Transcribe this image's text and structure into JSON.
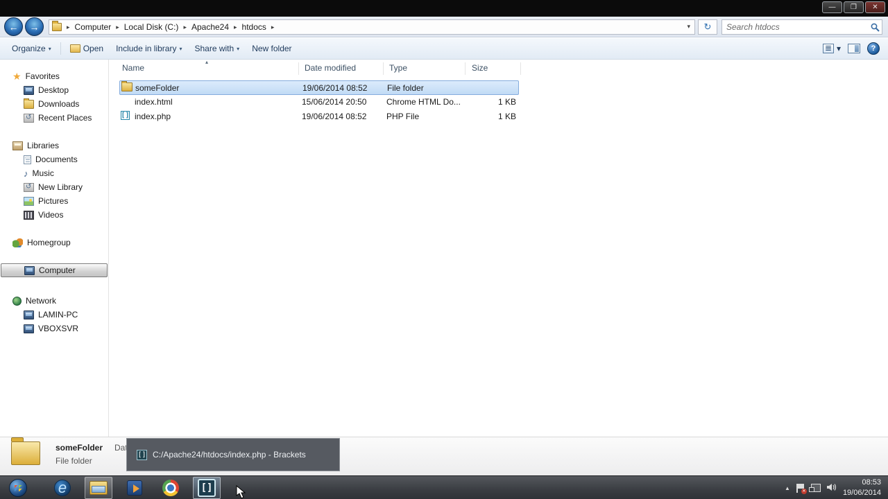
{
  "window": {
    "controls": {
      "minimize": "—",
      "restore": "❐",
      "close": "✕"
    }
  },
  "address_bar": {
    "breadcrumb": {
      "segments": [
        "Computer",
        "Local Disk (C:)",
        "Apache24",
        "htdocs"
      ],
      "separator": "▸",
      "dropdown_glyph": "▾"
    },
    "refresh_glyph": "↻",
    "search_placeholder": "Search htdocs"
  },
  "toolbar": {
    "organize_label": "Organize",
    "open_label": "Open",
    "include_label": "Include in library",
    "share_label": "Share with",
    "newfolder_label": "New folder",
    "caret_glyph": "▾",
    "help_glyph": "?"
  },
  "sidebar": {
    "favorites": {
      "label": "Favorites",
      "items": [
        "Desktop",
        "Downloads",
        "Recent Places"
      ]
    },
    "libraries": {
      "label": "Libraries",
      "items": [
        "Documents",
        "Music",
        "New Library",
        "Pictures",
        "Videos"
      ]
    },
    "homegroup": {
      "label": "Homegroup"
    },
    "computer": {
      "label": "Computer"
    },
    "network": {
      "label": "Network",
      "items": [
        "LAMIN-PC",
        "VBOXSVR"
      ]
    }
  },
  "file_list": {
    "columns": {
      "name": "Name",
      "date": "Date modified",
      "type": "Type",
      "size": "Size"
    },
    "sort_glyph": "▴",
    "rows": [
      {
        "name": "someFolder",
        "date": "19/06/2014 08:52",
        "type": "File folder",
        "size": ""
      },
      {
        "name": "index.html",
        "date": "15/06/2014 20:50",
        "type": "Chrome HTML Do...",
        "size": "1 KB"
      },
      {
        "name": "index.php",
        "date": "19/06/2014 08:52",
        "type": "PHP File",
        "size": "1 KB"
      }
    ]
  },
  "details_pane": {
    "name": "someFolder",
    "extra_label": "Date",
    "type": "File folder"
  },
  "tooltip": {
    "icon_glyph": "[]",
    "text": "C:/Apache24/htdocs/index.php - Brackets"
  },
  "taskbar": {
    "brackets_glyph": "[]",
    "ie_glyph": "e",
    "tray": {
      "flag_x": "✕",
      "volume_glyph": "🔉",
      "caret_glyph": "▲",
      "time": "08:53",
      "date": "19/06/2014"
    }
  }
}
